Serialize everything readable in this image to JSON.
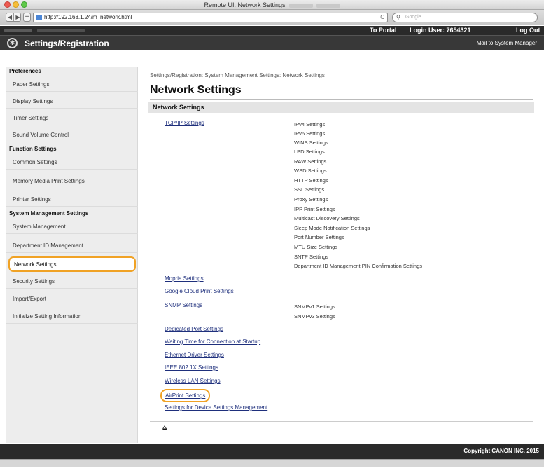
{
  "window": {
    "title": "Remote UI: Network Settings"
  },
  "browser": {
    "url": "http://192.168.1.24/m_network.html",
    "search_placeholder": "Google",
    "reload_glyph": "C"
  },
  "topbar": {
    "to_portal": "To Portal",
    "login_user": "Login User:  7654321",
    "logout": "Log Out"
  },
  "header": {
    "title": "Settings/Registration",
    "mail_link": "Mail to System Manager"
  },
  "sidebar": {
    "sections": [
      {
        "title": "Preferences",
        "items": [
          "Paper Settings",
          "Display Settings",
          "Timer Settings",
          "Sound Volume Control"
        ]
      },
      {
        "title": "Function Settings",
        "items": [
          "Common Settings",
          "Memory Media Print Settings",
          "Printer Settings"
        ]
      },
      {
        "title": "System Management Settings",
        "items": [
          "System Management",
          "Department ID Management",
          "Network Settings",
          "Security Settings",
          "Import/Export",
          "Initialize Setting Information"
        ]
      }
    ],
    "active": "Network Settings"
  },
  "main": {
    "breadcrumb": "Settings/Registration: System Management Settings: Network Settings",
    "title": "Network Settings",
    "section_title": "Network Settings",
    "tcpip": {
      "label": "TCP/IP Settings",
      "subs": [
        "IPv4 Settings",
        "IPv6 Settings",
        "WINS Settings",
        "LPD Settings",
        "RAW Settings",
        "WSD Settings",
        "HTTP Settings",
        "SSL Settings",
        "Proxy Settings",
        "IPP Print Settings",
        "Multicast Discovery Settings",
        "Sleep Mode Notification Settings",
        "Port Number Settings",
        "MTU Size Settings",
        "SNTP Settings",
        "Department ID Management PIN Confirmation Settings"
      ]
    },
    "mopria": "Mopria Settings",
    "google_cloud": "Google Cloud Print Settings",
    "snmp": {
      "label": "SNMP Settings",
      "subs": [
        "SNMPv1 Settings",
        "SNMPv3 Settings"
      ]
    },
    "dedicated_port": "Dedicated Port Settings",
    "waiting_time": "Waiting Time for Connection at Startup",
    "ethernet": "Ethernet Driver Settings",
    "ieee": "IEEE 802.1X Settings",
    "wireless": "Wireless LAN Settings",
    "airprint": "AirPrint Settings",
    "device_mgmt": "Settings for Device Settings Management",
    "top_glyph": "⩠"
  },
  "footer": {
    "copyright": "Copyright CANON INC. 2015"
  }
}
